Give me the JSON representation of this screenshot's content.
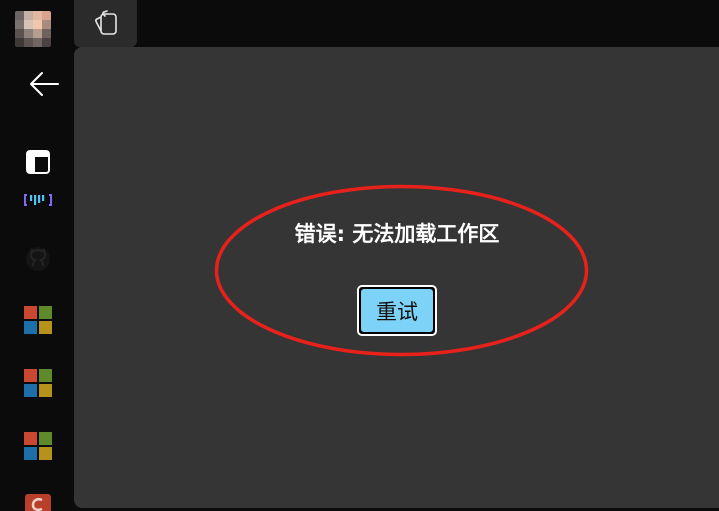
{
  "error": {
    "message": "错误: 无法加载工作区",
    "retry_label": "重试"
  },
  "icons": {
    "back": "back-arrow-icon",
    "tab": "workspaces-icon",
    "sidebar_toggle": "sidebar-toggle-icon",
    "app_brand": "brand-app-icon",
    "github": "github-icon",
    "microsoft": "microsoft-icon",
    "partial_app": "app-icon"
  },
  "colors": {
    "page_background": "#0b0b0b",
    "panel_background": "#353535",
    "retry_button": "#7dd3f7",
    "annotation": "#e8211b"
  }
}
